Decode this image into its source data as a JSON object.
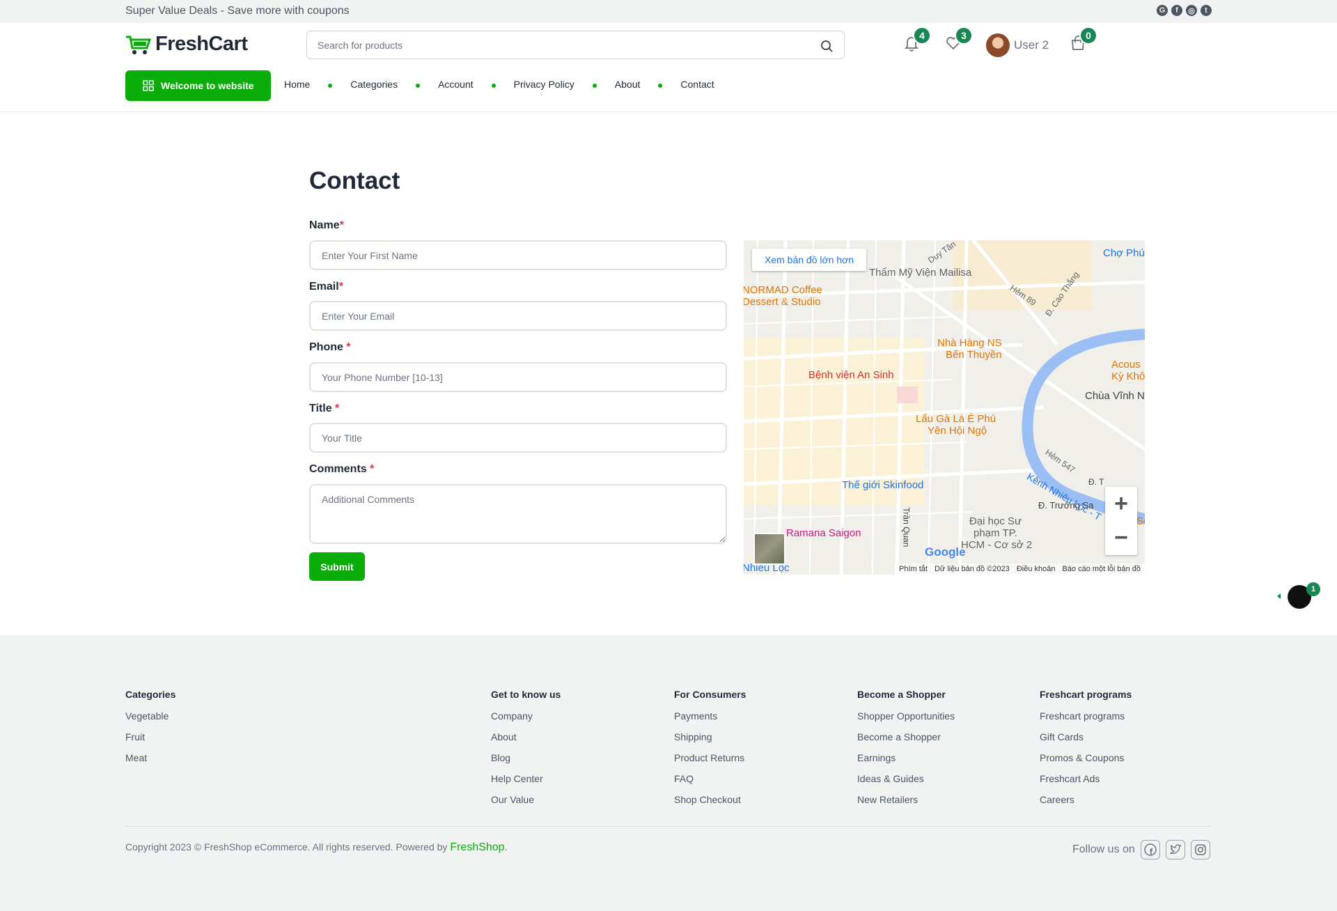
{
  "topbar": {
    "promo": "Super Value Deals - Save more with coupons",
    "social_icons": [
      "google-icon",
      "facebook-icon",
      "instagram-icon",
      "twitter-icon"
    ]
  },
  "header": {
    "brand": "FreshCart",
    "search_placeholder": "Search for products",
    "notifications_count": "4",
    "wishlist_count": "3",
    "user_name": "User 2",
    "cart_count": "0"
  },
  "nav": {
    "welcome_button": "Welcome to website",
    "items": [
      "Home",
      "Categories",
      "Account",
      "Privacy Policy",
      "About",
      "Contact"
    ]
  },
  "contact": {
    "title": "Contact",
    "fields": [
      {
        "label": "Name",
        "required": "*",
        "placeholder": "Enter Your First Name"
      },
      {
        "label": "Email",
        "required": "*",
        "placeholder": "Enter Your Email"
      },
      {
        "label": "Phone ",
        "required": "*",
        "placeholder": "Your Phone Number [10-13]"
      },
      {
        "label": "Title ",
        "required": "*",
        "placeholder": "Your Title"
      },
      {
        "label": "Comments ",
        "required": "*",
        "placeholder": "Additional Comments"
      }
    ],
    "submit": "Submit"
  },
  "map": {
    "view_larger": "Xem bản đồ lớn hơn",
    "labels": [
      "Thẩm Mỹ Viện Mailisa",
      "NORMAD Coffee",
      "Dessert & Studio",
      "Nhà Hàng NS",
      "Bến Thuyền",
      "Bệnh viện An Sinh",
      "Lẩu Gà Lá É Phú",
      "Yên Hội Ngộ",
      "Thế giới Skinfood",
      "Ramana Saigon",
      "Đại học Sư",
      "phạm TP.",
      "HCM - Cơ sở 2",
      "Chùa Vĩnh N",
      "Chợ Phú",
      "Acous",
      "Kỳ Khô",
      "Duy Tân",
      "Hẻm 89",
      "Đ. Cao Thắng",
      "Hẻm 547",
      "Kênh Nhiêu Lộc - T",
      "Đ. Trường Sa",
      "Trần Quan",
      "Nhiêu Lộc",
      "Đ. T",
      "Sơ"
    ],
    "google": "Google",
    "shortcuts": "Phím tắt",
    "map_data": "Dữ liệu bản đồ ©2023",
    "terms": "Điều khoản",
    "report": "Báo cáo một lỗi bản đồ"
  },
  "chat": {
    "badge": "1"
  },
  "footer": {
    "columns": [
      {
        "title": "Categories",
        "links": [
          "Vegetable",
          "Fruit",
          "Meat"
        ]
      },
      {
        "title": "Get to know us",
        "links": [
          "Company",
          "About",
          "Blog",
          "Help Center",
          "Our Value"
        ]
      },
      {
        "title": "For Consumers",
        "links": [
          "Payments",
          "Shipping",
          "Product Returns",
          "FAQ",
          "Shop Checkout"
        ]
      },
      {
        "title": "Become a Shopper",
        "links": [
          "Shopper Opportunities",
          "Become a Shopper",
          "Earnings",
          "Ideas & Guides",
          "New Retailers"
        ]
      },
      {
        "title": "Freshcart programs",
        "links": [
          "Freshcart programs",
          "Gift Cards",
          "Promos & Coupons",
          "Freshcart Ads",
          "Careers"
        ]
      }
    ],
    "copyright": "Copyright 2023 © FreshShop eCommerce. All rights reserved. Powered by ",
    "powered_brand": "FreshShop",
    "period": ".",
    "follow": "Follow us on",
    "follow_icons": [
      "facebook-icon",
      "twitter-icon",
      "instagram-icon"
    ]
  },
  "colors": {
    "accent": "#0aad0a",
    "badge": "#198754",
    "required": "#dc3545"
  }
}
